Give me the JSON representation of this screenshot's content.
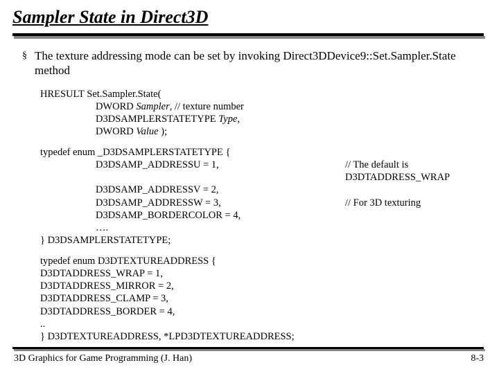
{
  "title": "Sampler State in Direct3D",
  "bullet": {
    "mark": "§",
    "text": "The texture addressing mode can be set by invoking Direct3DDevice9::Set.Sampler.State method"
  },
  "block1": {
    "l1": "HRESULT Set.Sampler.State(",
    "l2a": "DWORD ",
    "l2b": "Sampler",
    "l2c": ",    // texture number",
    "l3a": "D3DSAMPLERSTATETYPE ",
    "l3b": "Type",
    "l3c": ",",
    "l4a": "DWORD ",
    "l4b": "Value",
    "l4c": " );"
  },
  "block2": {
    "l1": "typedef enum _D3DSAMPLERSTATETYPE {",
    "r1l": "D3DSAMP_ADDRESSU = 1,",
    "r1r": "// The default is D3DTADDRESS_WRAP",
    "r2l": "D3DSAMP_ADDRESSV = 2,",
    "r2r": "",
    "r3l": "D3DSAMP_ADDRESSW = 3,",
    "r3r": "// For 3D texturing",
    "r4l": "D3DSAMP_BORDERCOLOR = 4,",
    "r5l": "….",
    "l6": "} D3DSAMPLERSTATETYPE;"
  },
  "block3": {
    "l1": "typedef enum D3DTEXTUREADDRESS {",
    "l2": "D3DTADDRESS_WRAP = 1,",
    "l3": "D3DTADDRESS_MIRROR = 2,",
    "l4": "D3DTADDRESS_CLAMP = 3,",
    "l5": "D3DTADDRESS_BORDER = 4,",
    "l6": "..",
    "l7": "} D3DTEXTUREADDRESS, *LPD3DTEXTUREADDRESS;"
  },
  "footer": {
    "left": "3D Graphics for Game Programming (J. Han)",
    "right": "8-3"
  }
}
